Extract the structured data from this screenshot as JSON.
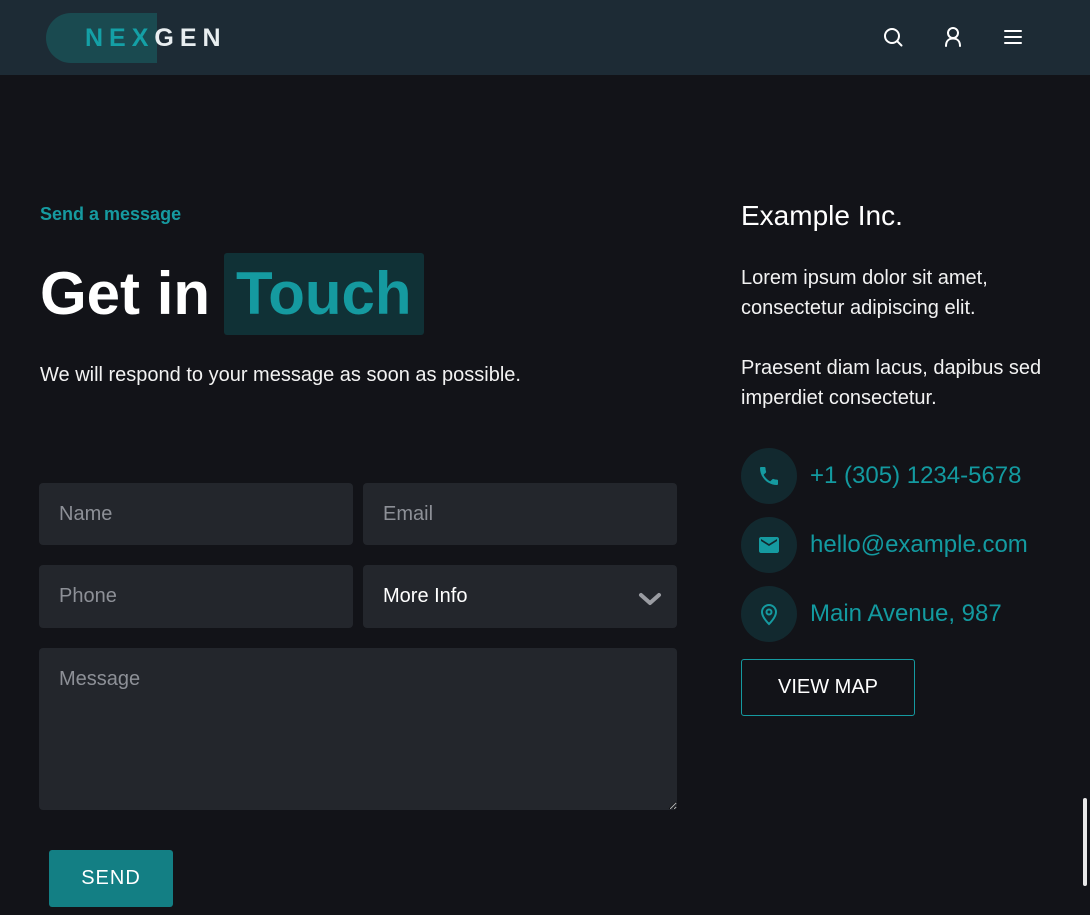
{
  "brand": {
    "logo_part1": "NEX",
    "logo_part2": "GEN",
    "accent_color": "#14a0a6",
    "background_color": "#121318",
    "header_color": "#1d2b35"
  },
  "header": {
    "icons": [
      "search-icon",
      "user-icon",
      "menu-icon"
    ]
  },
  "contact_form": {
    "eyebrow": "Send a message",
    "title_part1": "Get in",
    "title_part2": "Touch",
    "lead": "We will respond to your message as soon as possible.",
    "name_placeholder": "Name",
    "email_placeholder": "Email",
    "phone_placeholder": "Phone",
    "select_value": "More Info",
    "message_placeholder": "Message",
    "send_label": "SEND"
  },
  "company": {
    "name": "Example Inc.",
    "paragraph1": "Lorem ipsum dolor sit amet, consectetur adipiscing elit.",
    "paragraph2": "Praesent diam lacus, dapibus sed imperdiet consectetur.",
    "phone": "+1 (305) 1234-5678",
    "email": "hello@example.com",
    "address": "Main Avenue, 987",
    "map_button": "VIEW MAP"
  }
}
